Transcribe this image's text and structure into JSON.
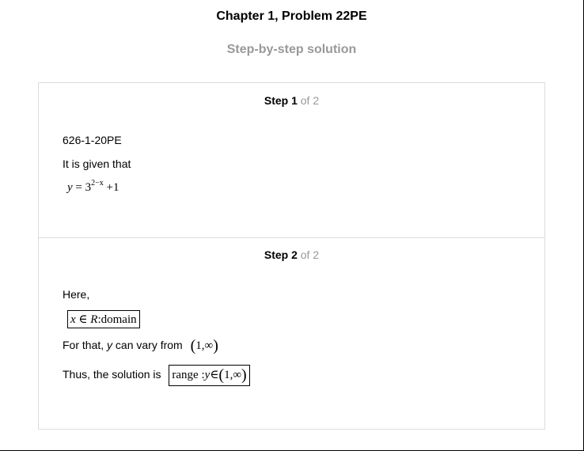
{
  "header": {
    "title": "Chapter 1, Problem 22PE",
    "subtitle": "Step-by-step solution"
  },
  "steps": [
    {
      "label": "Step 1",
      "of": "of 2",
      "image_label": "626-1-20PE",
      "intro": "It is given that",
      "equation": {
        "lhs": "y",
        "eq": " = 3",
        "exponent": "2−x",
        "rest": " +1"
      }
    },
    {
      "label": "Step 2",
      "of": "of 2",
      "here": "Here,",
      "domain_box": {
        "var": "x",
        "elem": " ∈ ",
        "set": "R",
        "text": ":domain"
      },
      "vary": {
        "prefix": "For that, ",
        "var": "y",
        "suffix": " can vary from",
        "interval": "1,∞"
      },
      "conclusion": {
        "prefix": "Thus, the solution is",
        "range_text": "range :",
        "var": "y",
        "elem": "∈",
        "interval": "1,∞"
      }
    }
  ]
}
